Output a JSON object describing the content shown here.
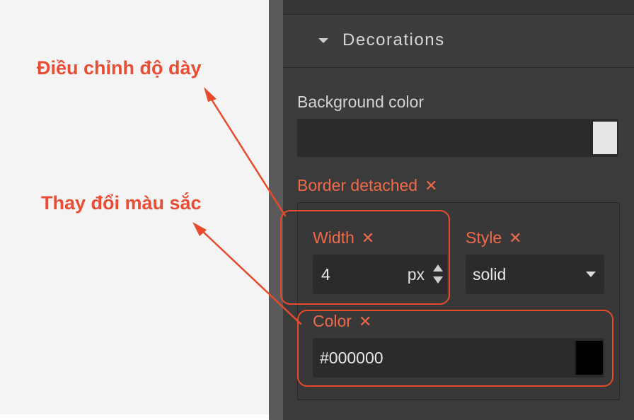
{
  "annotations": {
    "adjust_width": "Điều chỉnh độ dày",
    "change_color": "Thay đổi màu sắc"
  },
  "panel": {
    "section_title": "Decorations",
    "background_color_label": "Background color",
    "background_color_value": "#e6e6e6",
    "border_detached_label": "Border detached",
    "width_label": "Width",
    "width_value": "4",
    "width_unit": "px",
    "style_label": "Style",
    "style_value": "solid",
    "color_label": "Color",
    "color_value": "#000000",
    "close_glyph": "✕"
  },
  "colors": {
    "accent": "#f06a4a",
    "annotation": "#e94d33",
    "panel_bg": "#3b3b3b",
    "input_bg": "#2b2b2b"
  }
}
